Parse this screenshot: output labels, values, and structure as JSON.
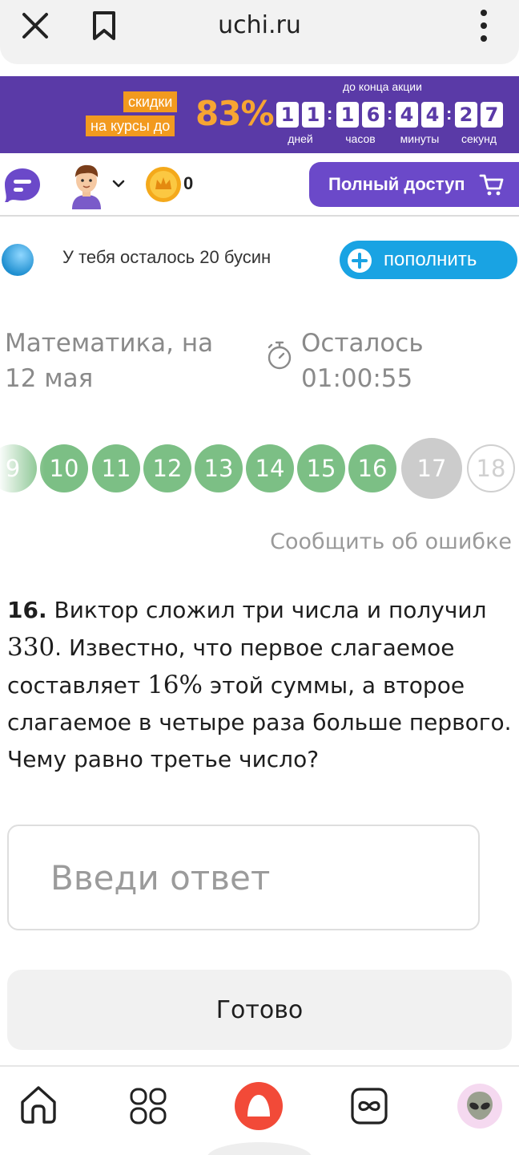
{
  "browser": {
    "url": "uchi.ru"
  },
  "promo": {
    "tag_line1": "скидки",
    "tag_line2": "на курсы до",
    "percent": "83%",
    "until_label": "до конца акции",
    "countdown": {
      "days": [
        "1",
        "1"
      ],
      "hours": [
        "1",
        "6"
      ],
      "minutes": [
        "4",
        "4"
      ],
      "seconds": [
        "2",
        "7"
      ]
    },
    "units": {
      "days": "дней",
      "hours": "часов",
      "minutes": "минуты",
      "seconds": "секунд"
    },
    "colors": {
      "background": "#5a3aa7",
      "accent": "#f29a1f"
    }
  },
  "header": {
    "coin_count": "0",
    "full_access_label": "Полный доступ"
  },
  "beads": {
    "text": "У тебя осталось 20 бусин",
    "topup_label": "пополнить"
  },
  "test": {
    "subject": "Математика, на 12 мая",
    "remaining": "Осталось 01:00:55"
  },
  "questions_nav": [
    {
      "num": "9",
      "state": "done"
    },
    {
      "num": "10",
      "state": "done"
    },
    {
      "num": "11",
      "state": "done"
    },
    {
      "num": "12",
      "state": "done"
    },
    {
      "num": "13",
      "state": "done"
    },
    {
      "num": "14",
      "state": "done"
    },
    {
      "num": "15",
      "state": "done"
    },
    {
      "num": "16",
      "state": "done"
    },
    {
      "num": "17",
      "state": "current"
    },
    {
      "num": "18",
      "state": "future"
    }
  ],
  "report_label": "Сообщить об ошибке",
  "question": {
    "number": "16.",
    "part1": "Виктор сложил три числа и получил",
    "math1": "330",
    "part2": ". Известно, что первое слагаемое составляет",
    "math2": "16%",
    "part3": "этой суммы, а второе слагаемое в четыре раза больше первого. Чему равно третье число?"
  },
  "answer": {
    "placeholder": "Введи ответ",
    "submit_label": "Готово"
  },
  "bottom_nav": [
    {
      "icon": "home-icon"
    },
    {
      "icon": "services-grid-icon"
    },
    {
      "icon": "alice-assistant-icon"
    },
    {
      "icon": "infinity-icon"
    },
    {
      "icon": "alien-avatar-icon"
    }
  ]
}
